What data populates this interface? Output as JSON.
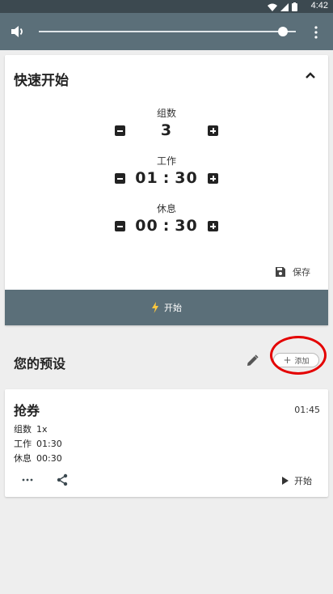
{
  "status_bar": {
    "time": "4:42"
  },
  "player": {
    "volume": 0.95,
    "icons": {
      "volume": "volume-icon",
      "menu": "more-vert-icon"
    }
  },
  "quick_start": {
    "title": "快速开始",
    "sets": {
      "label": "组数",
      "value": "3"
    },
    "work": {
      "label": "工作",
      "minutes": "01",
      "seconds": "30"
    },
    "rest": {
      "label": "休息",
      "minutes": "00",
      "seconds": "30"
    },
    "colon": ":",
    "save_label": "保存",
    "start_label": "开始"
  },
  "presets": {
    "title": "您的预设",
    "add_label": "添加",
    "items": [
      {
        "name": "抢券",
        "total": "01:45",
        "sets_label": "组数",
        "sets_value": "1x",
        "work_label": "工作",
        "work_value": "01:30",
        "rest_label": "休息",
        "rest_value": "00:30",
        "start_label": "开始"
      }
    ]
  },
  "colors": {
    "toolbar": "#5b6f79",
    "status_bar": "#3c4950",
    "highlight": "#e40000",
    "bolt": "#ffc83d"
  }
}
